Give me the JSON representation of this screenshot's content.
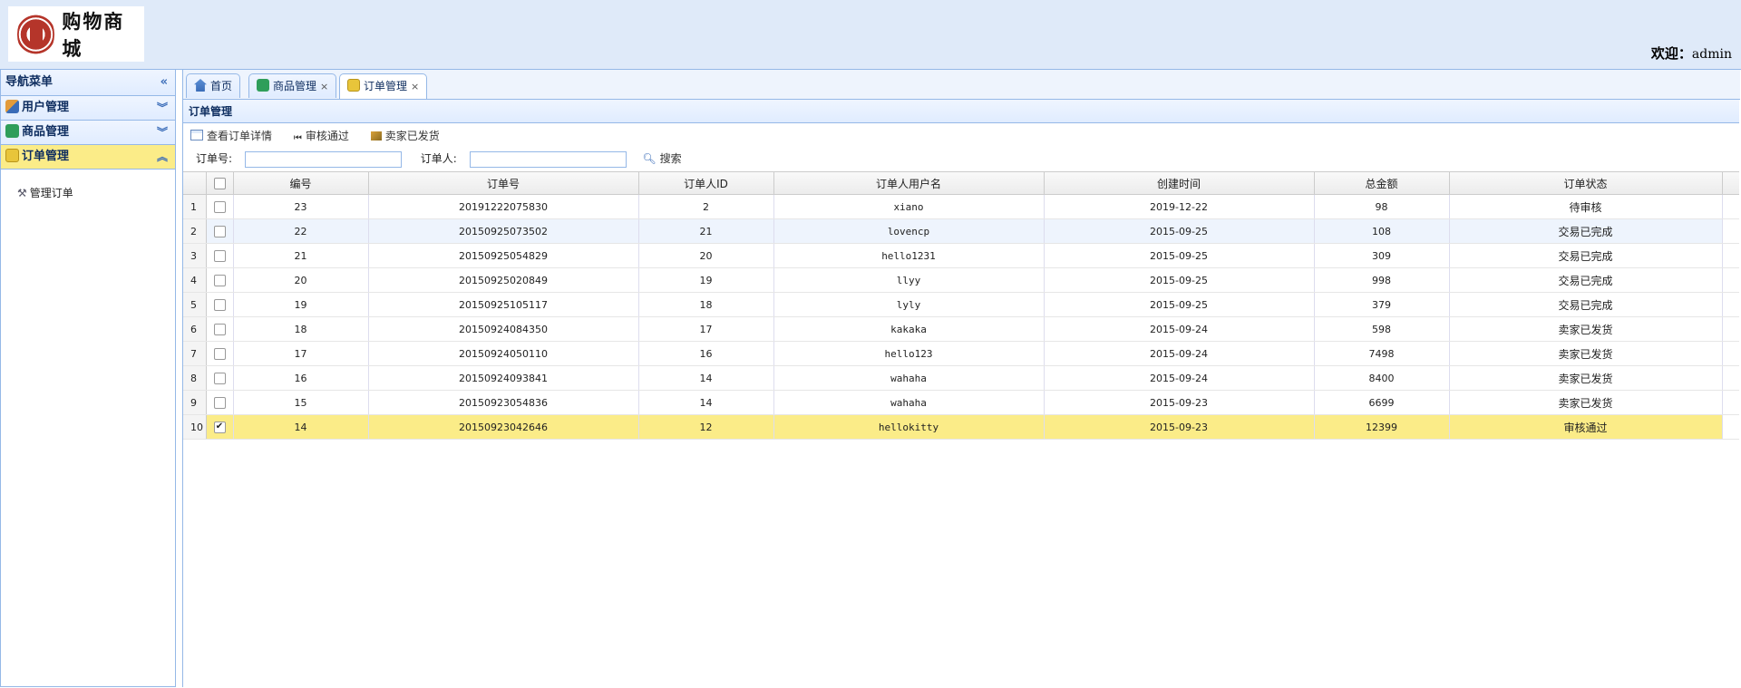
{
  "header": {
    "logo_text": "购物商城",
    "welcome_label": "欢迎：",
    "username": "admin"
  },
  "sidebar": {
    "title": "导航菜单",
    "groups": [
      {
        "label": "用户管理",
        "icon": "users-icon",
        "expanded": false
      },
      {
        "label": "商品管理",
        "icon": "product-icon",
        "expanded": false
      },
      {
        "label": "订单管理",
        "icon": "order-icon",
        "expanded": true
      }
    ],
    "sub_items": [
      {
        "label": "管理订单",
        "icon": "wrench-icon"
      }
    ]
  },
  "tabs": [
    {
      "label": "首页",
      "icon": "home-icon",
      "closable": false
    },
    {
      "label": "商品管理",
      "icon": "product-icon",
      "closable": true
    },
    {
      "label": "订单管理",
      "icon": "order-icon",
      "closable": true,
      "active": true
    }
  ],
  "panel": {
    "title": "订单管理"
  },
  "toolbar": {
    "view_detail": "查看订单详情",
    "approve": "审核通过",
    "shipped": "卖家已发货"
  },
  "search": {
    "order_no_label": "订单号:",
    "orderer_label": "订单人:",
    "button": "搜索"
  },
  "table": {
    "columns": [
      "编号",
      "订单号",
      "订单人ID",
      "订单人用户名",
      "创建时间",
      "总金额",
      "订单状态"
    ],
    "rows": [
      {
        "rn": "1",
        "checked": false,
        "id": "23",
        "order_no": "20191222075830",
        "uid": "2",
        "username": "xiano",
        "created": "2019-12-22",
        "total": "98",
        "status": "待审核"
      },
      {
        "rn": "2",
        "checked": false,
        "id": "22",
        "order_no": "20150925073502",
        "uid": "21",
        "username": "lovencp",
        "created": "2015-09-25",
        "total": "108",
        "status": "交易已完成"
      },
      {
        "rn": "3",
        "checked": false,
        "id": "21",
        "order_no": "20150925054829",
        "uid": "20",
        "username": "hello1231",
        "created": "2015-09-25",
        "total": "309",
        "status": "交易已完成"
      },
      {
        "rn": "4",
        "checked": false,
        "id": "20",
        "order_no": "20150925020849",
        "uid": "19",
        "username": "llyy",
        "created": "2015-09-25",
        "total": "998",
        "status": "交易已完成"
      },
      {
        "rn": "5",
        "checked": false,
        "id": "19",
        "order_no": "20150925105117",
        "uid": "18",
        "username": "lyly",
        "created": "2015-09-25",
        "total": "379",
        "status": "交易已完成"
      },
      {
        "rn": "6",
        "checked": false,
        "id": "18",
        "order_no": "20150924084350",
        "uid": "17",
        "username": "kakaka",
        "created": "2015-09-24",
        "total": "598",
        "status": "卖家已发货"
      },
      {
        "rn": "7",
        "checked": false,
        "id": "17",
        "order_no": "20150924050110",
        "uid": "16",
        "username": "hello123",
        "created": "2015-09-24",
        "total": "7498",
        "status": "卖家已发货"
      },
      {
        "rn": "8",
        "checked": false,
        "id": "16",
        "order_no": "20150924093841",
        "uid": "14",
        "username": "wahaha",
        "created": "2015-09-24",
        "total": "8400",
        "status": "卖家已发货"
      },
      {
        "rn": "9",
        "checked": false,
        "id": "15",
        "order_no": "20150923054836",
        "uid": "14",
        "username": "wahaha",
        "created": "2015-09-23",
        "total": "6699",
        "status": "卖家已发货"
      },
      {
        "rn": "10",
        "checked": true,
        "id": "14",
        "order_no": "20150923042646",
        "uid": "12",
        "username": "hellokitty",
        "created": "2015-09-23",
        "total": "12399",
        "status": "审核通过"
      }
    ]
  },
  "colors": {
    "header_bg": "#dfeaf9",
    "border": "#95b8e7",
    "selected_row": "#fbec88",
    "alt_row": "#eef4fd"
  }
}
